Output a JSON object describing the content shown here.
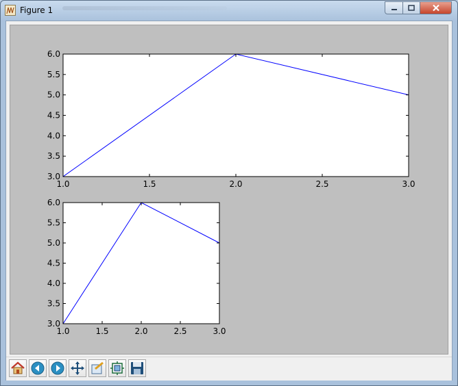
{
  "window": {
    "title": "Figure 1",
    "icon": "matplotlib-figure-icon"
  },
  "toolbar": {
    "buttons": [
      {
        "name": "home-button",
        "icon": "home-icon"
      },
      {
        "name": "back-button",
        "icon": "back-arrow-icon"
      },
      {
        "name": "forward-button",
        "icon": "forward-arrow-icon"
      },
      {
        "name": "pan-button",
        "icon": "move-arrows-icon"
      },
      {
        "name": "zoom-button",
        "icon": "zoom-rect-icon"
      },
      {
        "name": "configure-subplots-button",
        "icon": "subplots-config-icon"
      },
      {
        "name": "save-button",
        "icon": "floppy-disk-icon"
      }
    ]
  },
  "colors": {
    "figure_bg": "#bfbfbf",
    "axes_bg": "#ffffff",
    "line": "#0000ff"
  },
  "chart_data": [
    {
      "type": "line",
      "x": [
        1,
        2,
        3
      ],
      "series": [
        {
          "values": [
            3,
            6,
            5
          ]
        }
      ],
      "xlim": [
        1.0,
        3.0
      ],
      "ylim": [
        3.0,
        6.0
      ],
      "xticks": [
        "1.0",
        "1.5",
        "2.0",
        "2.5",
        "3.0"
      ],
      "yticks": [
        "3.0",
        "3.5",
        "4.0",
        "4.5",
        "5.0",
        "5.5",
        "6.0"
      ],
      "grid": false
    },
    {
      "type": "line",
      "x": [
        1,
        2,
        3
      ],
      "series": [
        {
          "values": [
            3,
            6,
            5
          ]
        }
      ],
      "xlim": [
        1.0,
        3.0
      ],
      "ylim": [
        3.0,
        6.0
      ],
      "xticks": [
        "1.0",
        "1.5",
        "2.0",
        "2.5",
        "3.0"
      ],
      "yticks": [
        "3.0",
        "3.5",
        "4.0",
        "4.5",
        "5.0",
        "5.5",
        "6.0"
      ],
      "grid": false
    }
  ]
}
